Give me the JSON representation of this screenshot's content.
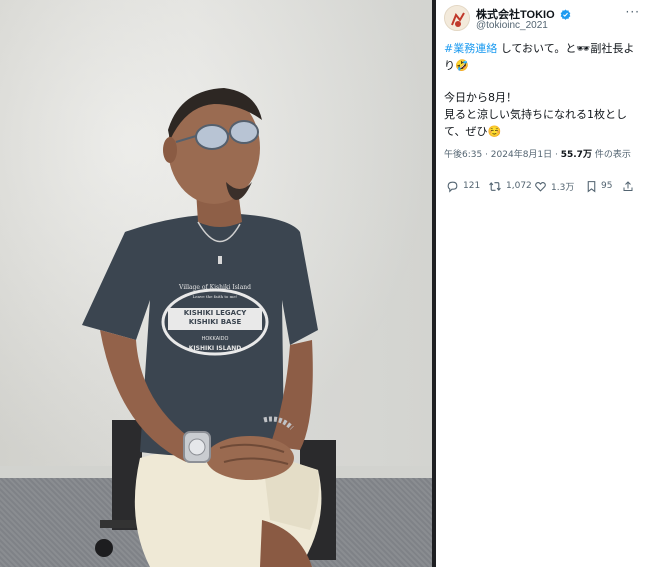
{
  "tweet": {
    "account_name": "株式会社TOKIO",
    "handle": "@tokioinc_2021",
    "hashtag": "#業務連絡",
    "line1_rest": " しておいて。と🕶副社長より🤣",
    "line2": "今日から8月！",
    "line3": "見ると涼しい気持ちになれる1枚として、ぜひ☺️",
    "timestamp": "午後6:35 · 2024年8月1日 · ",
    "views_count": "55.7万",
    "views_suffix": " 件の表示",
    "more_label": "···",
    "verified": true
  },
  "actions": {
    "reply": {
      "count": "121",
      "icon": "reply-icon"
    },
    "retweet": {
      "count": "1,072",
      "icon": "retweet-icon"
    },
    "like": {
      "count": "1.3万",
      "icon": "heart-icon"
    },
    "views": {
      "count": "95",
      "icon": "views-icon"
    },
    "share": {
      "icon": "share-icon"
    }
  },
  "photo": {
    "shirt_text_top": "Village of Kishiki Island",
    "shirt_text_small": "Leave the faith to me!",
    "shirt_text_main1": "KISHIKI LEGACY",
    "shirt_text_main2": "KISHIKI BASE",
    "shirt_text_place": "HOKKAIDO",
    "shirt_text_bottom": "KISHIKI ISLAND"
  },
  "colors": {
    "accent": "#1d9bf0",
    "text": "#0f1419",
    "muted": "#536471",
    "shirt": "#3b4550"
  }
}
